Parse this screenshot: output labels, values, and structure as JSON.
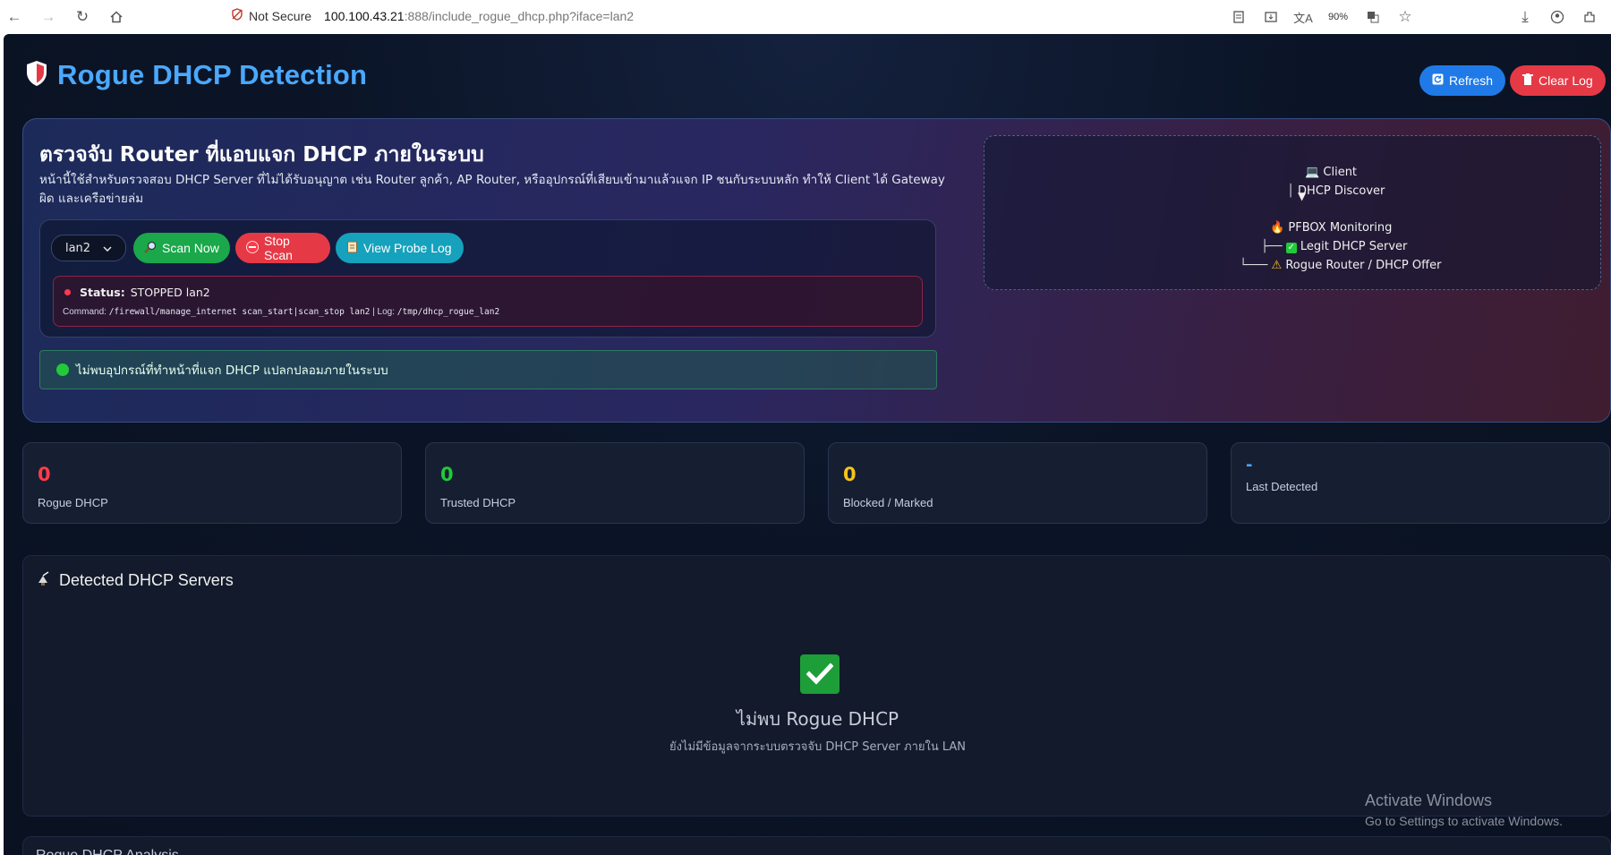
{
  "browser": {
    "security_label": "Not Secure",
    "url_host": "100.100.43.21",
    "url_path": ":888/include_rogue_dhcp.php?iface=lan2",
    "zoom": "90%"
  },
  "app": {
    "title": "Rogue DHCP Detection",
    "refresh_label": "Refresh",
    "clear_log_label": "Clear Log"
  },
  "hero": {
    "heading": "ตรวจจับ Router ที่แอบแจก DHCP ภายในระบบ",
    "description": "หน้านี้ใช้สำหรับตรวจสอบ DHCP Server ที่ไม่ได้รับอนุญาต เช่น Router ลูกค้า, AP Router, หรืออุปกรณ์ที่เสียบเข้ามาแล้วแจก IP ชนกับระบบหลัก ทำให้ Client ได้ Gateway ผิด และเครือข่ายล่ม",
    "interface_selected": "lan2",
    "scan_now_label": "Scan Now",
    "stop_scan_label": "Stop Scan",
    "view_probe_log_label": "View Probe Log",
    "status_label": "Status:",
    "status_value": "STOPPED lan2",
    "command_label": "Command:",
    "command_value": "/firewall/manage_internet scan_start|scan_stop lan2",
    "log_label": "| Log:",
    "log_value": "/tmp/dhcp_rogue_lan2",
    "ok_message": "ไม่พบอุปกรณ์ที่ทำหน้าที่แจก DHCP แปลกปลอมภายในระบบ"
  },
  "flow": {
    "client": "Client",
    "discover": "DHCP Discover",
    "arrow": "▼",
    "monitor": "PFBOX Monitoring",
    "legit": "Legit DHCP Server",
    "rogue": "Rogue Router / DHCP Offer"
  },
  "stats": [
    {
      "value": "0",
      "label": "Rogue DHCP",
      "color": "#ff3b4a"
    },
    {
      "value": "0",
      "label": "Trusted DHCP",
      "color": "#22c93a"
    },
    {
      "value": "0",
      "label": "Blocked / Marked",
      "color": "#f5c518"
    },
    {
      "value": "-",
      "label": "Last Detected",
      "color": "#4aa8ff"
    }
  ],
  "servers": {
    "title": "Detected DHCP Servers",
    "empty_title": "ไม่พบ Rogue DHCP",
    "empty_sub": "ยังไม่มีข้อมูลจากระบบตรวจจับ DHCP Server ภายใน LAN"
  },
  "next_panel": {
    "title": "Rogue DHCP Analysis"
  },
  "watermark": {
    "line1": "Activate Windows",
    "line2": "Go to Settings to activate Windows."
  },
  "colors": {
    "accent": "#4aa8ff",
    "success": "#1aa84a",
    "danger": "#e63946",
    "info": "#16a1bd"
  }
}
